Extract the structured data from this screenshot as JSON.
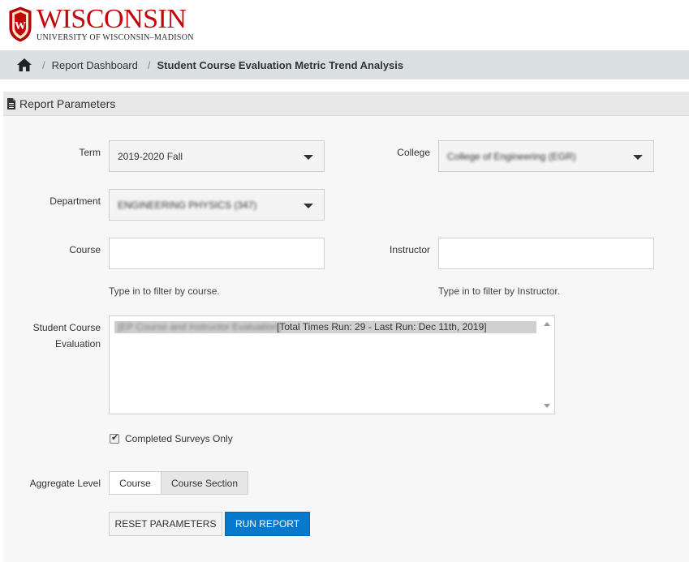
{
  "brand": {
    "title": "WISCONSIN",
    "subtitle": "UNIVERSITY OF WISCONSIN–MADISON",
    "crest_letter": "W",
    "color": "#c5050c"
  },
  "breadcrumb": {
    "home_icon": "home-icon",
    "items": [
      "Report Dashboard",
      "Student Course Evaluation Metric Trend Analysis"
    ],
    "separator": "/"
  },
  "panel": {
    "icon": "document-icon",
    "title": "Report Parameters"
  },
  "form": {
    "term": {
      "label": "Term",
      "value": "2019-2020 Fall"
    },
    "college": {
      "label": "College",
      "value": "College of Engineering (EGR)"
    },
    "department": {
      "label": "Department",
      "value": "ENGINEERING PHYSICS (347)"
    },
    "course": {
      "label": "Course",
      "value": "",
      "hint": "Type in to filter by course."
    },
    "instructor": {
      "label": "Instructor",
      "value": "",
      "hint": "Type in to filter by Instructor."
    },
    "evaluation": {
      "label_line1": "Student Course",
      "label_line2": "Evaluation",
      "option_blurred": "[EP Course and Instructor Evaluation]",
      "option_text": "[Total Times Run: 29 - Last Run: Dec 11th, 2019]"
    },
    "completed_only": {
      "label": "Completed Surveys Only",
      "checked": true,
      "mark": "✔"
    },
    "aggregate": {
      "label": "Aggregate Level",
      "options": [
        "Course",
        "Course Section"
      ],
      "selected": "Course Section"
    }
  },
  "buttons": {
    "reset": "RESET PARAMETERS",
    "run": "RUN REPORT",
    "run_color": "#0479ce"
  }
}
